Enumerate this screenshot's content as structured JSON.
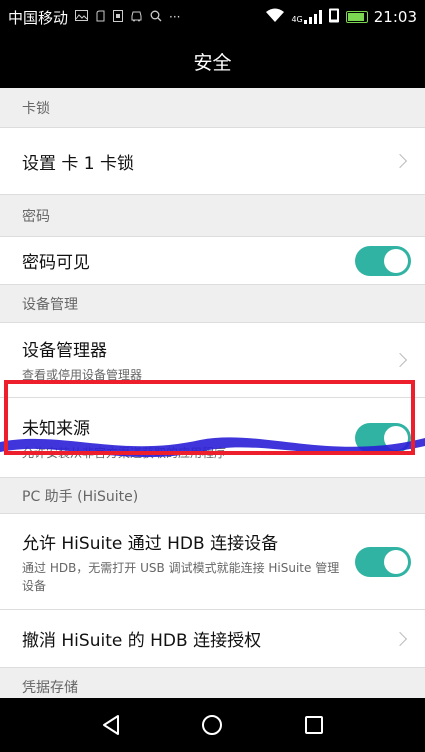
{
  "status_bar": {
    "carrier": "中国移动",
    "more": "···",
    "network_type": "4G",
    "time": "21:03",
    "icons": [
      "image-icon",
      "clip-icon",
      "sim-icon",
      "car-icon",
      "search-icon",
      "wifi-icon",
      "signal-icon",
      "phone-icon",
      "battery-icon"
    ]
  },
  "header": {
    "title": "安全"
  },
  "sections": [
    {
      "header": "卡锁",
      "items": [
        {
          "title": "设置 卡 1 卡锁",
          "type": "chevron"
        }
      ]
    },
    {
      "header": "密码",
      "items": [
        {
          "title": "密码可见",
          "type": "toggle",
          "checked": true
        }
      ]
    },
    {
      "header": "设备管理",
      "items": [
        {
          "title": "设备管理器",
          "subtitle": "查看或停用设备管理器",
          "type": "chevron"
        },
        {
          "title": "未知来源",
          "subtitle": "允许安装从非官方渠道获取的应用程序",
          "type": "toggle",
          "checked": true
        }
      ]
    },
    {
      "header": "PC 助手 (HiSuite)",
      "items": [
        {
          "title": "允许 HiSuite 通过 HDB 连接设备",
          "subtitle": "通过 HDB，无需打开 USB 调试模式就能连接 HiSuite 管理设备",
          "type": "toggle",
          "checked": true
        },
        {
          "title": "撤消 HiSuite 的 HDB 连接授权",
          "type": "chevron"
        }
      ]
    },
    {
      "header": "凭据存储",
      "items": []
    }
  ],
  "colors": {
    "toggle_on": "#31b3a4",
    "highlight": "#ee1f2c",
    "scribble": "#2a1fd6"
  },
  "nav": {
    "back_icon": "back-triangle-icon",
    "home_icon": "home-circle-icon",
    "recents_icon": "recents-square-icon"
  }
}
